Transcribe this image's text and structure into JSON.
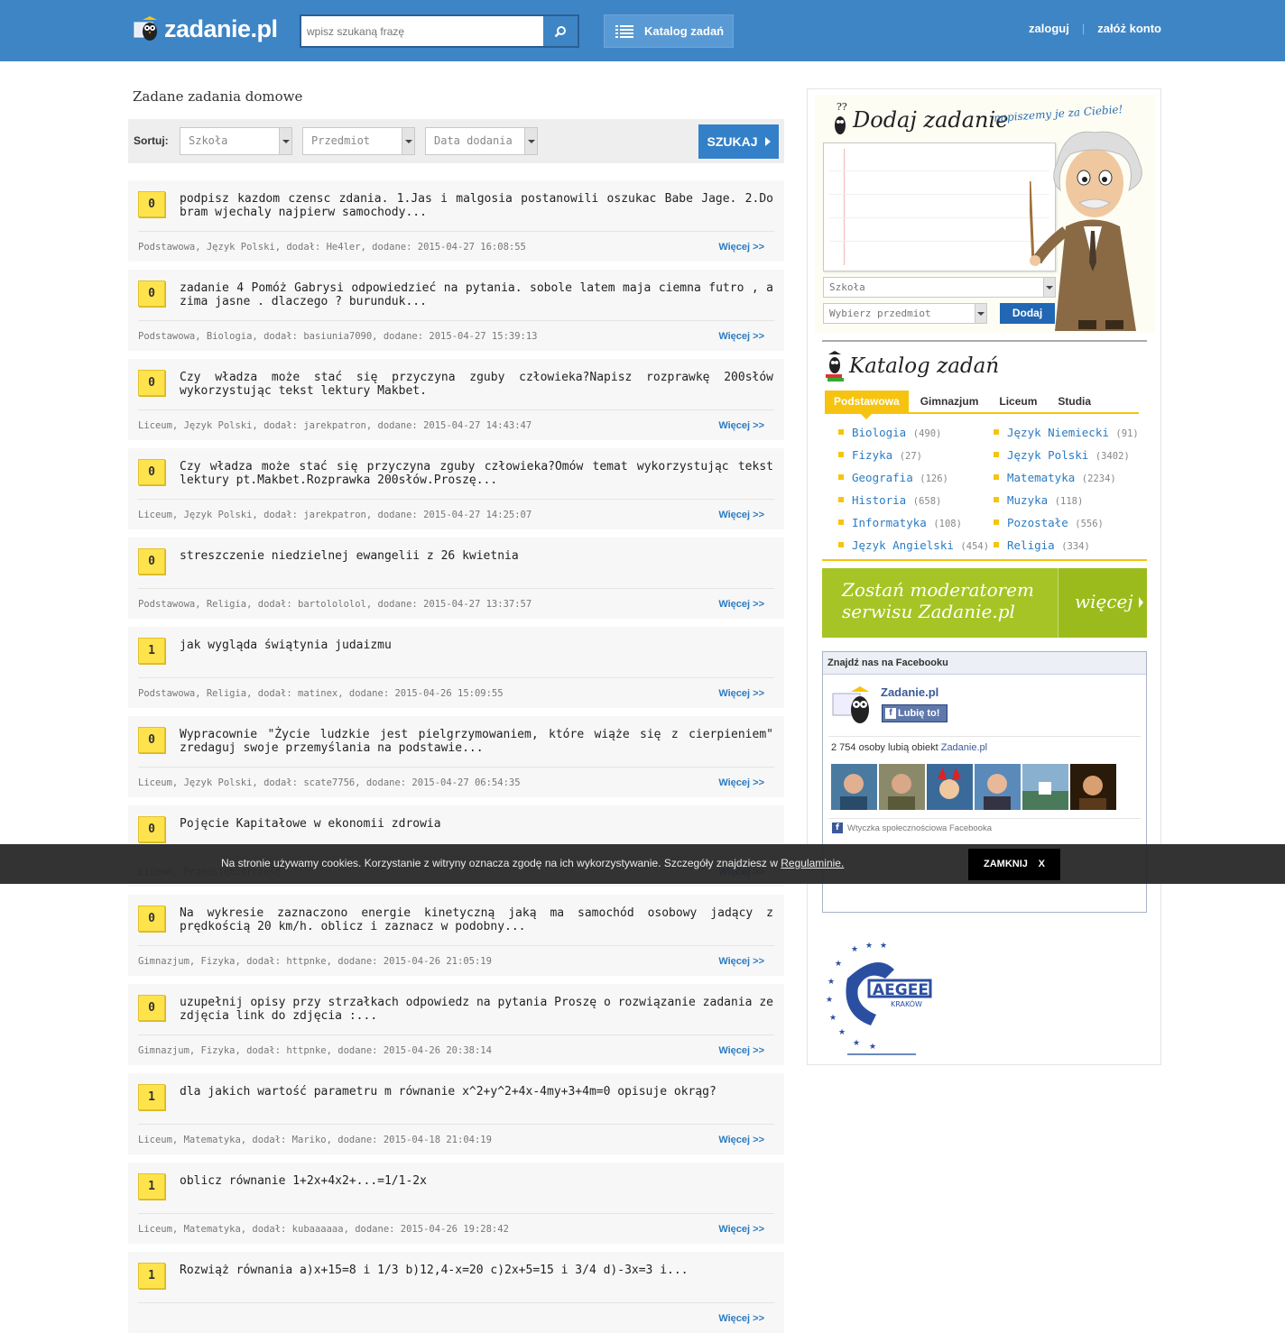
{
  "header": {
    "logo_text": "zadanie.pl",
    "search_placeholder": "wpisz szukaną frazę",
    "catalog_label": "Katalog zadań",
    "login_label": "zaloguj",
    "register_label": "załóż konto",
    "brand_color": "#3e85c6"
  },
  "main": {
    "title": "Zadane zadania domowe",
    "sort_label": "Sortuj:",
    "filters": [
      "Szkoła",
      "Przedmiot",
      "Data dodania"
    ],
    "search_button": "SZUKAJ",
    "more_label": "Więcej >>",
    "questions": [
      {
        "score": "0",
        "text": "podpisz kazdom czensc zdania. 1.Jas i malgosia postanowili oszukac Babe Jage. 2.Do bram wjechaly najpierw samochody...",
        "meta": "Podstawowa, Język Polski, dodał: He4ler, dodane: 2015-04-27 16:08:55"
      },
      {
        "score": "0",
        "text": "zadanie 4 Pomóż Gabrysi odpowiedzieć na pytania. sobole latem maja ciemna futro , a zima jasne . dlaczego ? burunduk...",
        "meta": "Podstawowa, Biologia, dodał: basiunia7090, dodane: 2015-04-27 15:39:13"
      },
      {
        "score": "0",
        "text": "Czy władza może stać się przyczyna zguby człowieka?Napisz rozprawkę 200słów wykorzystując tekst lektury Makbet.",
        "meta": "Liceum, Język Polski, dodał: jarekpatron, dodane: 2015-04-27 14:43:47"
      },
      {
        "score": "0",
        "text": "Czy władza może stać się przyczyna zguby człowieka?Omów temat wykorzystując tekst lektury pt.Makbet.Rozprawka 200słów.Proszę...",
        "meta": "Liceum, Język Polski, dodał: jarekpatron, dodane: 2015-04-27 14:25:07"
      },
      {
        "score": "0",
        "text": "streszczenie niedzielnej ewangelii z 26 kwietnia",
        "meta": "Podstawowa, Religia, dodał: bartolololol, dodane: 2015-04-27 13:37:57"
      },
      {
        "score": "1",
        "text": "jak wygląda świątynia judaizmu",
        "meta": "Podstawowa, Religia, dodał: matinex, dodane: 2015-04-26 15:09:55"
      },
      {
        "score": "0",
        "text": "Wypracownie \"Życie ludzkie jest pielgrzymowaniem, które wiąże się z cierpieniem\" zredaguj swoje przemyślania na podstawie...",
        "meta": "Liceum, Język Polski, dodał: scate7756, dodane: 2015-04-27 06:54:35"
      },
      {
        "score": "0",
        "text": "Pojęcie Kapitałowe w ekonomii zdrowia",
        "meta": "Liceum, Przedsiębiorczość"
      },
      {
        "score": "0",
        "text": "Na wykresie zaznaczono energie kinetyczną jaką ma samochód osobowy jadący z prędkością 20 km/h. oblicz i zaznacz w podobny...",
        "meta": "Gimnazjum, Fizyka, dodał: httpnke, dodane: 2015-04-26 21:05:19"
      },
      {
        "score": "0",
        "text": "uzupełnij opisy przy strzałkach odpowiedz na pytania Proszę o rozwiązanie zadania ze zdjęcia link do zdjęcia :...",
        "meta": "Gimnazjum, Fizyka, dodał: httpnke, dodane: 2015-04-26 20:38:14"
      },
      {
        "score": "1",
        "text": "dla jakich wartość parametru m równanie x^2+y^2+4x-4my+3+4m=0 opisuje okrąg?",
        "meta": "Liceum, Matematyka, dodał: Mariko, dodane: 2015-04-18 21:04:19"
      },
      {
        "score": "1",
        "text": "oblicz równanie 1+2x+4x2+...=1/1-2x",
        "meta": "Liceum, Matematyka, dodał: kubaaaaaa, dodane: 2015-04-26 19:28:42"
      },
      {
        "score": "1",
        "text": "Rozwiąż równania a)x+15=8 i 1/3 b)12,4-x=20 c)2x+5=15 i 3/4 d)-3x=3 i...",
        "meta": ""
      }
    ]
  },
  "sidebar": {
    "dodaj_title": "Dodaj zadanie",
    "dodaj_subtitle": "napiszemy je za Ciebie!",
    "school_select": "Szkoła",
    "subject_select": "Wybierz przedmiot",
    "dodaj_button": "Dodaj",
    "catalog_title": "Katalog zadań",
    "tabs": [
      "Podstawowa",
      "Gimnazjum",
      "Liceum",
      "Studia"
    ],
    "subjects_left": [
      {
        "name": "Biologia",
        "count": "(490)"
      },
      {
        "name": "Fizyka",
        "count": "(27)"
      },
      {
        "name": "Geografia",
        "count": "(126)"
      },
      {
        "name": "Historia",
        "count": "(658)"
      },
      {
        "name": "Informatyka",
        "count": "(108)"
      },
      {
        "name": "Język Angielski",
        "count": "(454)"
      }
    ],
    "subjects_right": [
      {
        "name": "Język Niemiecki",
        "count": "(91)"
      },
      {
        "name": "Język Polski",
        "count": "(3402)"
      },
      {
        "name": "Matematyka",
        "count": "(2234)"
      },
      {
        "name": "Muzyka",
        "count": "(118)"
      },
      {
        "name": "Pozostałe",
        "count": "(556)"
      },
      {
        "name": "Religia",
        "count": "(334)"
      }
    ],
    "moderator_line1": "Zostań moderatorem",
    "moderator_line2": "serwisu Zadanie.pl",
    "moderator_more": "więcej",
    "facebook": {
      "header": "Znajdź nas na Facebooku",
      "page_name": "Zadanie.pl",
      "like_label": "Lubię to!",
      "count_text": "2 754 osoby lubią obiekt",
      "count_link": "Zadanie.pl",
      "plugin_label": "Wtyczka społecznościowa Facebooka"
    },
    "aegee_text": "KRAKÓW"
  },
  "cookie": {
    "text": "Na stronie używamy cookies. Korzystanie z witryny oznacza zgodę na ich wykorzystywanie. Szczegóły znajdziesz w",
    "link": "Regulaminie.",
    "close_label": "ZAMKNIJ",
    "close_x": "X"
  }
}
